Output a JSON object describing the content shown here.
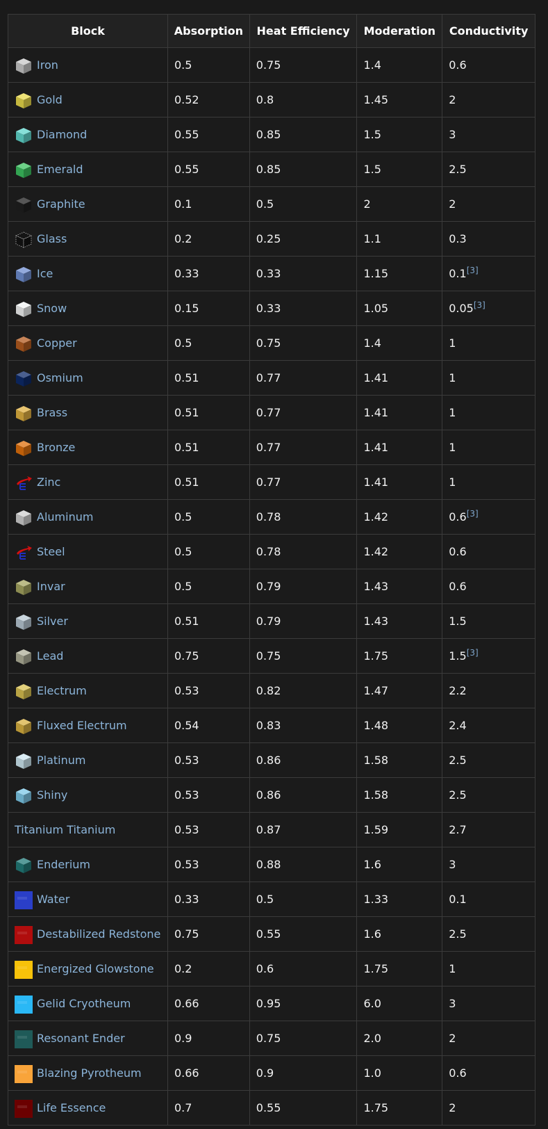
{
  "table": {
    "headers": [
      "Block",
      "Absorption",
      "Heat Efficiency",
      "Moderation",
      "Conductivity"
    ],
    "rows": [
      {
        "block": "Iron",
        "icon": "iron-block-icon",
        "icon_type": "cube",
        "color": "#c8c8c8",
        "absorption": "0.5",
        "heat_efficiency": "0.75",
        "moderation": "1.4",
        "conductivity": "0.6",
        "ref": ""
      },
      {
        "block": "Gold",
        "icon": "gold-block-icon",
        "icon_type": "cube",
        "color": "#e8d84a",
        "absorption": "0.52",
        "heat_efficiency": "0.8",
        "moderation": "1.45",
        "conductivity": "2",
        "ref": ""
      },
      {
        "block": "Diamond",
        "icon": "diamond-block-icon",
        "icon_type": "cube",
        "color": "#5fd6cc",
        "absorption": "0.55",
        "heat_efficiency": "0.85",
        "moderation": "1.5",
        "conductivity": "3",
        "ref": ""
      },
      {
        "block": "Emerald",
        "icon": "emerald-block-icon",
        "icon_type": "cube",
        "color": "#3cc160",
        "absorption": "0.55",
        "heat_efficiency": "0.85",
        "moderation": "1.5",
        "conductivity": "2.5",
        "ref": ""
      },
      {
        "block": "Graphite",
        "icon": "graphite-block-icon",
        "icon_type": "cube",
        "color": "#1e1e1e",
        "absorption": "0.1",
        "heat_efficiency": "0.5",
        "moderation": "2",
        "conductivity": "2",
        "ref": ""
      },
      {
        "block": "Glass",
        "icon": "glass-block-icon",
        "icon_type": "glass",
        "color": "#d0d0d0",
        "absorption": "0.2",
        "heat_efficiency": "0.25",
        "moderation": "1.1",
        "conductivity": "0.3",
        "ref": ""
      },
      {
        "block": "Ice",
        "icon": "ice-block-icon",
        "icon_type": "cube",
        "color": "#6f8ed0",
        "absorption": "0.33",
        "heat_efficiency": "0.33",
        "moderation": "1.15",
        "conductivity": "0.1",
        "ref": "[3]"
      },
      {
        "block": "Snow",
        "icon": "snow-block-icon",
        "icon_type": "cube",
        "color": "#f2f4f4",
        "absorption": "0.15",
        "heat_efficiency": "0.33",
        "moderation": "1.05",
        "conductivity": "0.05",
        "ref": "[3]"
      },
      {
        "block": "Copper",
        "icon": "copper-block-icon",
        "icon_type": "cube",
        "color": "#b35a1f",
        "absorption": "0.5",
        "heat_efficiency": "0.75",
        "moderation": "1.4",
        "conductivity": "1",
        "ref": ""
      },
      {
        "block": "Osmium",
        "icon": "osmium-block-icon",
        "icon_type": "cube",
        "color": "#0d2a6a",
        "absorption": "0.51",
        "heat_efficiency": "0.77",
        "moderation": "1.41",
        "conductivity": "1",
        "ref": ""
      },
      {
        "block": "Brass",
        "icon": "brass-block-icon",
        "icon_type": "cube",
        "color": "#e0b040",
        "absorption": "0.51",
        "heat_efficiency": "0.77",
        "moderation": "1.41",
        "conductivity": "1",
        "ref": ""
      },
      {
        "block": "Bronze",
        "icon": "bronze-block-icon",
        "icon_type": "cube",
        "color": "#e0700c",
        "absorption": "0.51",
        "heat_efficiency": "0.77",
        "moderation": "1.41",
        "conductivity": "1",
        "ref": ""
      },
      {
        "block": "Zinc",
        "icon": "missing-texture-icon",
        "icon_type": "missing",
        "color": "#d01010",
        "absorption": "0.51",
        "heat_efficiency": "0.77",
        "moderation": "1.41",
        "conductivity": "1",
        "ref": ""
      },
      {
        "block": "Aluminum",
        "icon": "aluminum-block-icon",
        "icon_type": "cube",
        "color": "#cfcfcf",
        "absorption": "0.5",
        "heat_efficiency": "0.78",
        "moderation": "1.42",
        "conductivity": "0.6",
        "ref": "[3]"
      },
      {
        "block": "Steel",
        "icon": "missing-texture-icon",
        "icon_type": "missing",
        "color": "#d01010",
        "absorption": "0.5",
        "heat_efficiency": "0.78",
        "moderation": "1.42",
        "conductivity": "0.6",
        "ref": ""
      },
      {
        "block": "Invar",
        "icon": "invar-block-icon",
        "icon_type": "cube",
        "color": "#a5a560",
        "absorption": "0.5",
        "heat_efficiency": "0.79",
        "moderation": "1.43",
        "conductivity": "0.6",
        "ref": ""
      },
      {
        "block": "Silver",
        "icon": "silver-block-icon",
        "icon_type": "cube",
        "color": "#b7c7d2",
        "absorption": "0.51",
        "heat_efficiency": "0.79",
        "moderation": "1.43",
        "conductivity": "1.5",
        "ref": ""
      },
      {
        "block": "Lead",
        "icon": "lead-block-icon",
        "icon_type": "cube",
        "color": "#b0b09a",
        "absorption": "0.75",
        "heat_efficiency": "0.75",
        "moderation": "1.75",
        "conductivity": "1.5",
        "ref": "[3]"
      },
      {
        "block": "Electrum",
        "icon": "electrum-block-icon",
        "icon_type": "cube",
        "color": "#d8c050",
        "absorption": "0.53",
        "heat_efficiency": "0.82",
        "moderation": "1.47",
        "conductivity": "2.2",
        "ref": ""
      },
      {
        "block": "Fluxed Electrum",
        "icon": "fluxed-electrum-block-icon",
        "icon_type": "cube",
        "color": "#d8b040",
        "absorption": "0.54",
        "heat_efficiency": "0.83",
        "moderation": "1.48",
        "conductivity": "2.4",
        "ref": ""
      },
      {
        "block": "Platinum",
        "icon": "platinum-block-icon",
        "icon_type": "cube",
        "color": "#cde6f0",
        "absorption": "0.53",
        "heat_efficiency": "0.86",
        "moderation": "1.58",
        "conductivity": "2.5",
        "ref": ""
      },
      {
        "block": "Shiny",
        "icon": "shiny-block-icon",
        "icon_type": "cube",
        "color": "#7cc8e8",
        "absorption": "0.53",
        "heat_efficiency": "0.86",
        "moderation": "1.58",
        "conductivity": "2.5",
        "ref": ""
      },
      {
        "block": "Titanium Titanium",
        "icon": "",
        "icon_type": "none",
        "color": "",
        "absorption": "0.53",
        "heat_efficiency": "0.87",
        "moderation": "1.59",
        "conductivity": "2.7",
        "ref": ""
      },
      {
        "block": "Enderium",
        "icon": "enderium-block-icon",
        "icon_type": "cube",
        "color": "#227a78",
        "absorption": "0.53",
        "heat_efficiency": "0.88",
        "moderation": "1.6",
        "conductivity": "3",
        "ref": ""
      },
      {
        "block": "Water",
        "icon": "water-fluid-icon",
        "icon_type": "flat",
        "color": "#2a3fc8",
        "absorption": "0.33",
        "heat_efficiency": "0.5",
        "moderation": "1.33",
        "conductivity": "0.1",
        "ref": ""
      },
      {
        "block": "Destabilized Redstone",
        "icon": "destabilized-redstone-fluid-icon",
        "icon_type": "flat",
        "color": "#b00d0d",
        "absorption": "0.75",
        "heat_efficiency": "0.55",
        "moderation": "1.6",
        "conductivity": "2.5",
        "ref": ""
      },
      {
        "block": "Energized Glowstone",
        "icon": "energized-glowstone-fluid-icon",
        "icon_type": "flat",
        "color": "#f7c20a",
        "absorption": "0.2",
        "heat_efficiency": "0.6",
        "moderation": "1.75",
        "conductivity": "1",
        "ref": ""
      },
      {
        "block": "Gelid Cryotheum",
        "icon": "gelid-cryotheum-fluid-icon",
        "icon_type": "flat",
        "color": "#2ab8f5",
        "absorption": "0.66",
        "heat_efficiency": "0.95",
        "moderation": "6.0",
        "conductivity": "3",
        "ref": ""
      },
      {
        "block": "Resonant Ender",
        "icon": "resonant-ender-fluid-icon",
        "icon_type": "flat",
        "color": "#1f5a58",
        "absorption": "0.9",
        "heat_efficiency": "0.75",
        "moderation": "2.0",
        "conductivity": "2",
        "ref": ""
      },
      {
        "block": "Blazing Pyrotheum",
        "icon": "blazing-pyrotheum-fluid-icon",
        "icon_type": "flat",
        "color": "#f9a43a",
        "absorption": "0.66",
        "heat_efficiency": "0.9",
        "moderation": "1.0",
        "conductivity": "0.6",
        "ref": ""
      },
      {
        "block": "Life Essence",
        "icon": "life-essence-fluid-icon",
        "icon_type": "flat",
        "color": "#6b0000",
        "absorption": "0.7",
        "heat_efficiency": "0.55",
        "moderation": "1.75",
        "conductivity": "2",
        "ref": ""
      }
    ]
  }
}
